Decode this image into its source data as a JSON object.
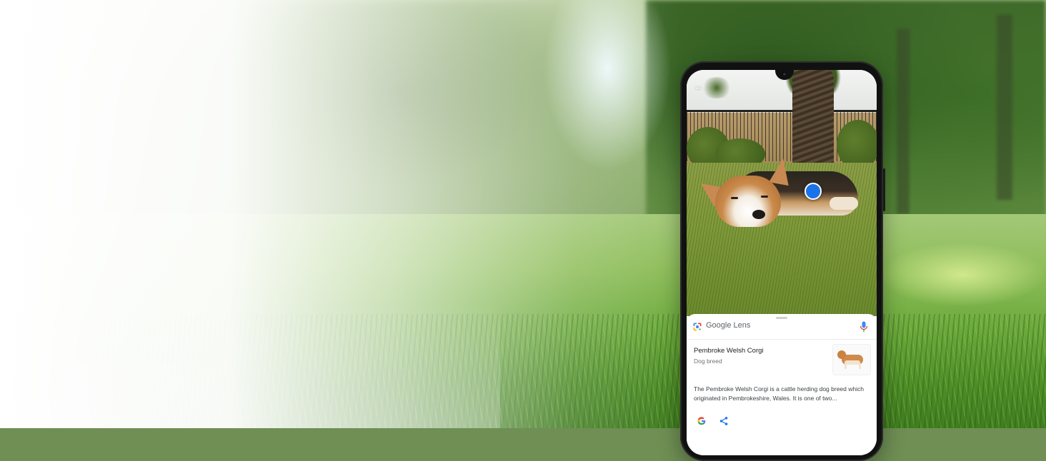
{
  "phone": {
    "lens_bar": {
      "brand_google": "Google",
      "brand_lens": "Lens"
    },
    "result": {
      "title": "Pembroke Welsh Corgi",
      "subtitle": "Dog breed",
      "description": "The Pembroke Welsh Corgi is a cattle herding dog breed which originated in Pembrokeshire, Wales. It is one of two..."
    },
    "icons": {
      "back": "back-arrow-icon",
      "lens": "google-lens-icon",
      "mic": "mic-icon",
      "google": "google-g-icon",
      "share": "share-icon"
    },
    "colors": {
      "lens_dot": "#1a73e8",
      "mic_blue": "#4285f4",
      "share_blue": "#1a73e8"
    }
  }
}
